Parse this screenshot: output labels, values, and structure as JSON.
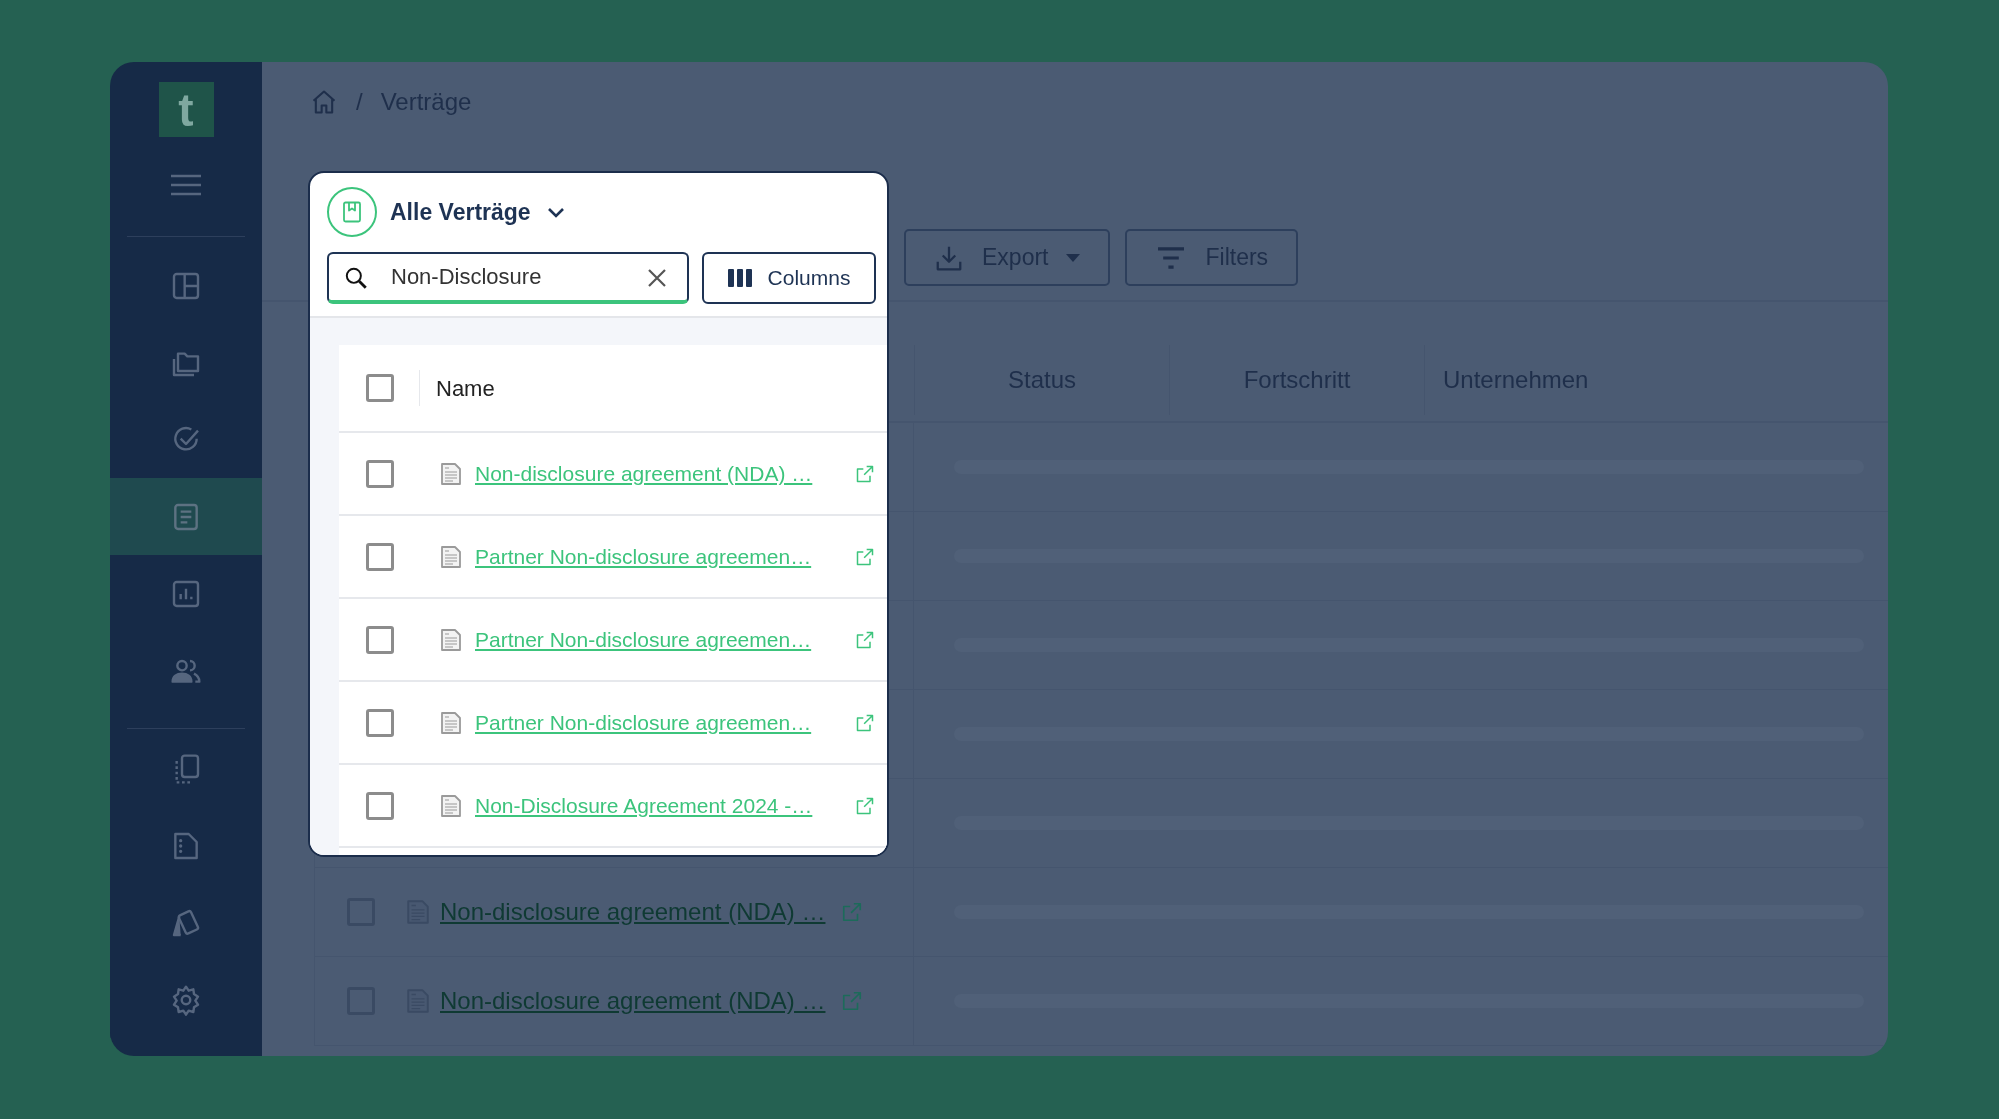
{
  "sidebar": {
    "logo": "t",
    "sections": [
      {
        "items": [
          {
            "kind": "layout",
            "selected": false
          },
          {
            "kind": "folders",
            "selected": false
          },
          {
            "kind": "check",
            "selected": false
          },
          {
            "kind": "list",
            "selected": true
          },
          {
            "kind": "chart",
            "selected": false
          },
          {
            "kind": "people",
            "selected": false
          }
        ]
      },
      {
        "items": [
          {
            "kind": "copy",
            "selected": false
          },
          {
            "kind": "file",
            "selected": false
          },
          {
            "kind": "cards",
            "selected": false
          },
          {
            "kind": "settings",
            "selected": false
          }
        ]
      }
    ]
  },
  "breadcrumb": {
    "separator": "/",
    "current": "Verträge"
  },
  "toolbar": {
    "buttons": [
      {
        "kind": "export",
        "label": "Export"
      },
      {
        "kind": "filter",
        "label": "Filters"
      }
    ]
  },
  "table": {
    "columns": [
      "Status",
      "Fortschritt",
      "Unternehmen"
    ],
    "rows": [
      {
        "name": "Non-disclosure agreement (NDA) …",
        "checked": false
      },
      {
        "name": "Non-disclosure agreement (NDA) …",
        "checked": false
      }
    ]
  },
  "view_menu": {
    "title": "Alle Verträge",
    "search": {
      "value": "Non-Disclosure"
    },
    "columns_button": "Columns",
    "table": {
      "header": "Name",
      "all_checked": false,
      "rows": [
        {
          "name": "Non-disclosure agreement (NDA) …",
          "checked": false
        },
        {
          "name": "Partner Non-disclosure agreemen…",
          "checked": false
        },
        {
          "name": "Partner Non-disclosure agreemen…",
          "checked": false
        },
        {
          "name": "Partner Non-disclosure agreemen…",
          "checked": false
        },
        {
          "name": "Non-Disclosure Agreement 2024 -…",
          "checked": false
        }
      ]
    }
  }
}
